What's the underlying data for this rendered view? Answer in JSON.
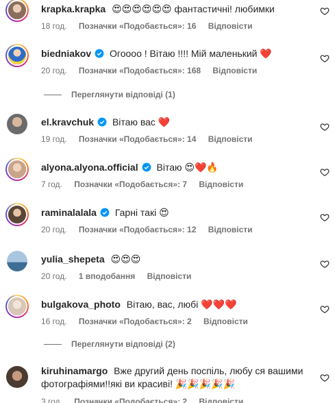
{
  "comments": [
    {
      "username": "krapka.krapka",
      "verified": false,
      "text": "😍😍😍😍😍😍 фантастичні! любимки",
      "time": "18 год.",
      "likes": "Позначки «Подобається»: 16",
      "reply": "Відповісти",
      "avatar_color": "#8a6d5a"
    },
    {
      "username": "biedniakov",
      "verified": true,
      "text": "Огоооо ! Вітаю !!!! Мій маленький ❤️",
      "time": "20 год.",
      "likes": "Позначки «Подобається»: 168",
      "reply": "Відповісти",
      "avatar_color": "#3a7bd5"
    },
    {
      "username": "el.kravchuk",
      "verified": true,
      "text": "Вітаю вас ❤️",
      "time": "19 год.",
      "likes": "Позначки «Подобається»: 14",
      "reply": "Відповісти",
      "avatar_color": "#6b6b6b"
    },
    {
      "username": "alyona.alyona.official",
      "verified": true,
      "text": "Вітаю 😍❤️🔥",
      "time": "7 год.",
      "likes": "Позначки «Подобається»: 7",
      "reply": "Відповісти",
      "avatar_color": "#c9a48a"
    },
    {
      "username": "raminalalala",
      "verified": true,
      "text": "Гарні такі 😍",
      "time": "20 год.",
      "likes": "Позначки «Подобається»: 12",
      "reply": "Відповісти",
      "avatar_color": "#5a4636"
    },
    {
      "username": "yulia_shepeta",
      "verified": false,
      "text": "😍😍😍",
      "time": "20 год.",
      "likes": "1 вподобання",
      "reply": "Відповісти",
      "avatar_color": "#7fa6c9"
    },
    {
      "username": "bulgakova_photo",
      "verified": false,
      "text": "Вітаю, вас, любі ❤️❤️❤️",
      "time": "16 год.",
      "likes": "Позначки «Подобається»: 2",
      "reply": "Відповісти",
      "avatar_color": "#d8c7b8"
    },
    {
      "username": "kiruhinamargo",
      "verified": false,
      "text": "Вже другий день поспіль, любу ся вашими фотографіями!!які ви красиві! 🎉🎉🎉🎉🎉",
      "time": "3 год.",
      "likes": "Позначки «Подобається»: 2",
      "reply": "Відповісти",
      "avatar_color": "#4a3a30"
    }
  ],
  "view_replies": [
    {
      "label": "Переглянути відповіді (1)"
    },
    {
      "label": "Переглянути відповіді (2)"
    }
  ],
  "colors": {
    "text": "#262626",
    "secondary": "#737373",
    "verified": "#0095f6",
    "heart": "#ed4956"
  }
}
